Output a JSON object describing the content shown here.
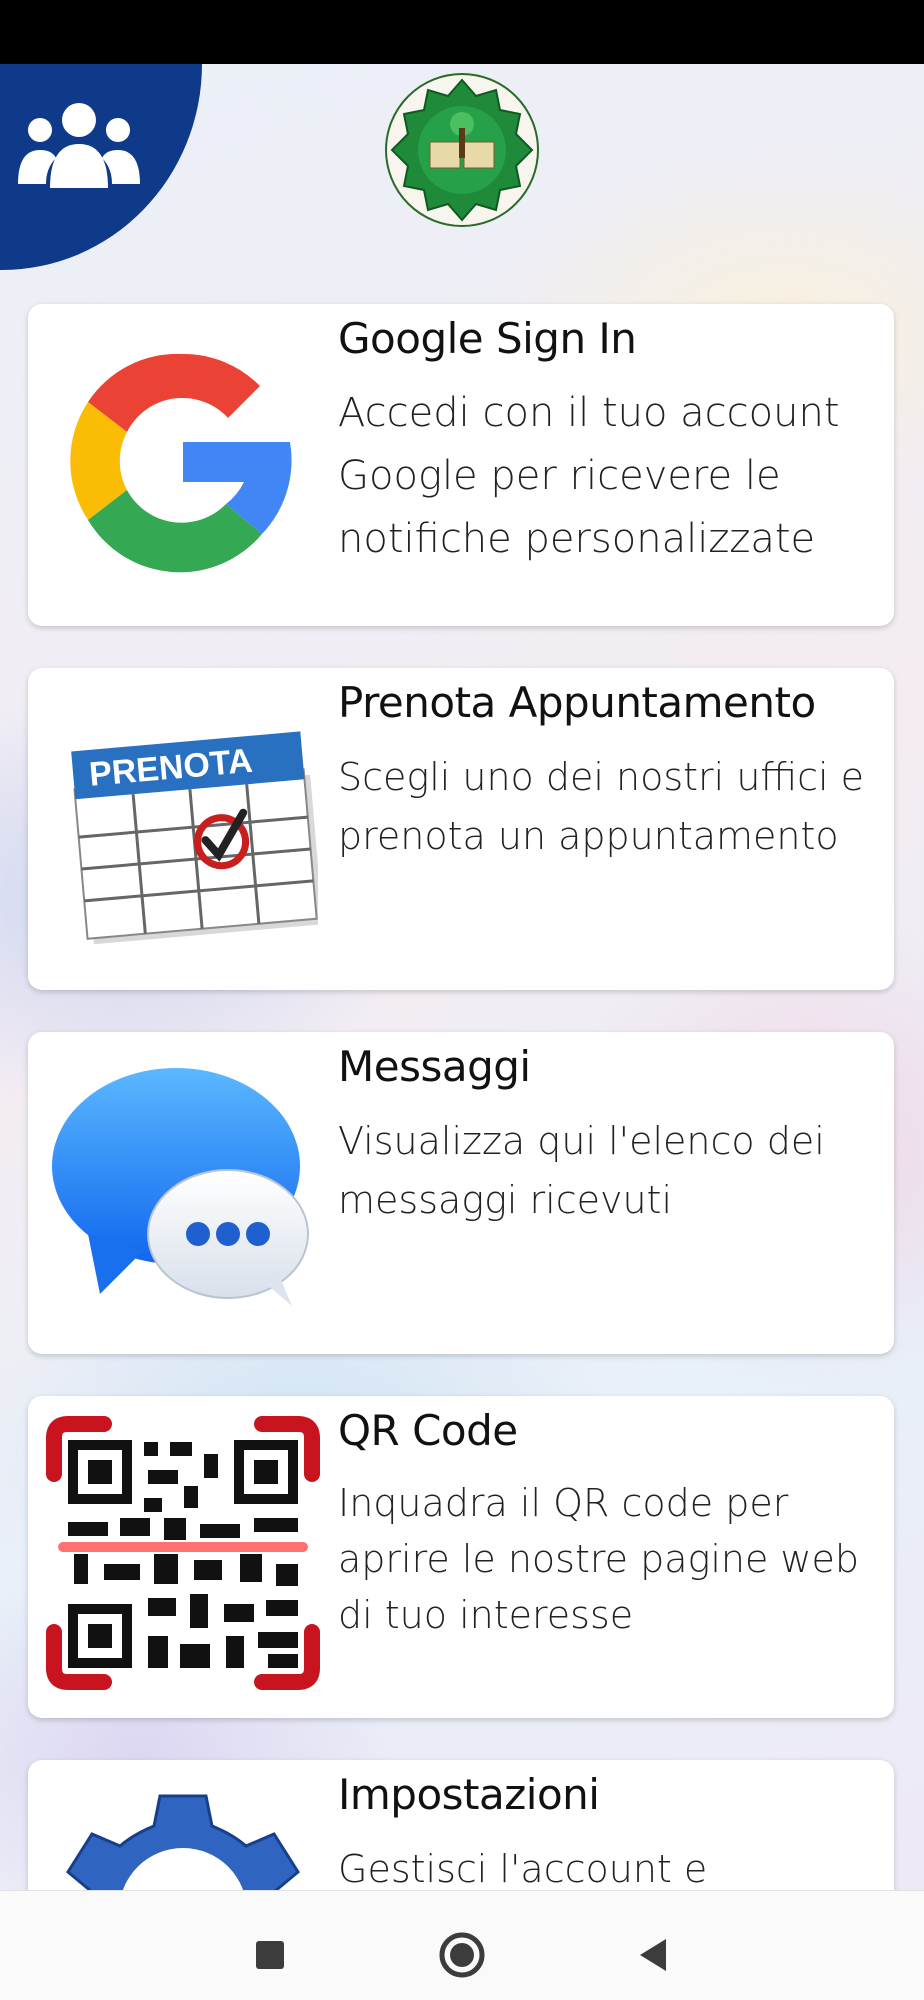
{
  "cards": [
    {
      "title": "Google Sign In",
      "desc": "Accedi con il tuo account Google per ricevere le notifiche personalizzate",
      "icon": "google-logo-icon"
    },
    {
      "title": "Prenota Appuntamento",
      "desc": "Scegli uno dei nostri uffici e prenota un appuntamento",
      "icon": "calendar-icon",
      "icon_label": "PRENOTA"
    },
    {
      "title": "Messaggi",
      "desc": "Visualizza qui l'elenco dei messaggi ricevuti",
      "icon": "chat-bubbles-icon"
    },
    {
      "title": "QR Code",
      "desc": "Inquadra il QR code per aprire le nostre pagine web di tuo interesse",
      "icon": "qr-scan-icon"
    },
    {
      "title": "Impostazioni",
      "desc": "Gestisci l'account e",
      "icon": "gear-icon"
    }
  ],
  "header": {
    "menu_icon": "group-icon",
    "logo": "school-logo"
  },
  "navbar": {
    "recents": "square-icon",
    "home": "circle-icon",
    "back": "triangle-back-icon"
  },
  "colors": {
    "corner": "#0f3a8a",
    "google_red": "#EA4335",
    "google_yellow": "#FBBC05",
    "google_green": "#34A853",
    "google_blue": "#4285F4"
  }
}
